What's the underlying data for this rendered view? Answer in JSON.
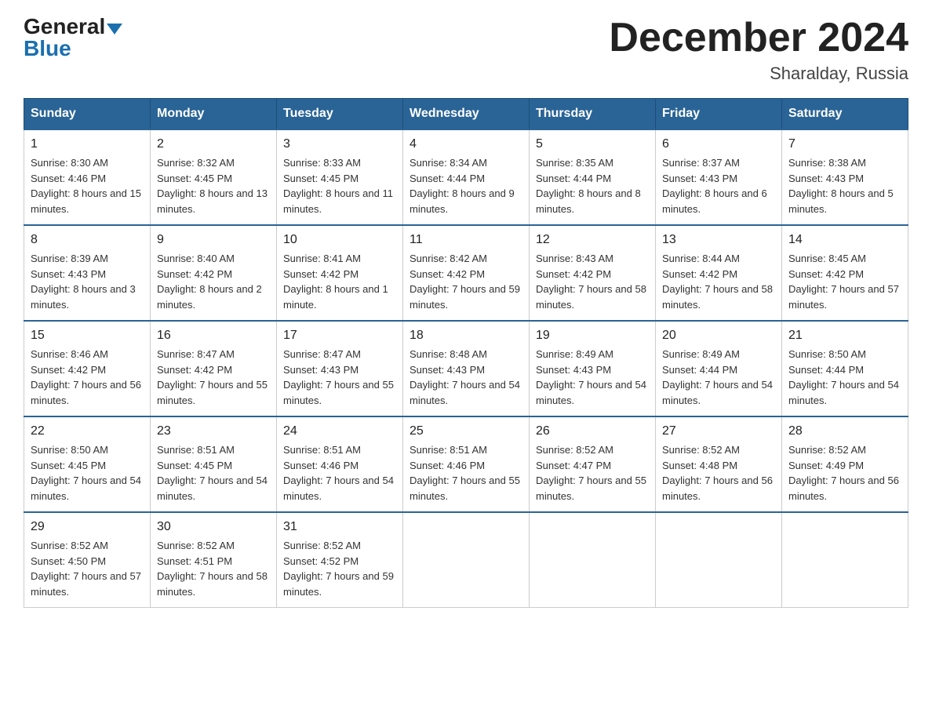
{
  "header": {
    "logo_general": "General",
    "logo_blue": "Blue",
    "month_title": "December 2024",
    "location": "Sharalday, Russia"
  },
  "days_of_week": [
    "Sunday",
    "Monday",
    "Tuesday",
    "Wednesday",
    "Thursday",
    "Friday",
    "Saturday"
  ],
  "weeks": [
    [
      {
        "day": "1",
        "sunrise": "8:30 AM",
        "sunset": "4:46 PM",
        "daylight": "8 hours and 15 minutes."
      },
      {
        "day": "2",
        "sunrise": "8:32 AM",
        "sunset": "4:45 PM",
        "daylight": "8 hours and 13 minutes."
      },
      {
        "day": "3",
        "sunrise": "8:33 AM",
        "sunset": "4:45 PM",
        "daylight": "8 hours and 11 minutes."
      },
      {
        "day": "4",
        "sunrise": "8:34 AM",
        "sunset": "4:44 PM",
        "daylight": "8 hours and 9 minutes."
      },
      {
        "day": "5",
        "sunrise": "8:35 AM",
        "sunset": "4:44 PM",
        "daylight": "8 hours and 8 minutes."
      },
      {
        "day": "6",
        "sunrise": "8:37 AM",
        "sunset": "4:43 PM",
        "daylight": "8 hours and 6 minutes."
      },
      {
        "day": "7",
        "sunrise": "8:38 AM",
        "sunset": "4:43 PM",
        "daylight": "8 hours and 5 minutes."
      }
    ],
    [
      {
        "day": "8",
        "sunrise": "8:39 AM",
        "sunset": "4:43 PM",
        "daylight": "8 hours and 3 minutes."
      },
      {
        "day": "9",
        "sunrise": "8:40 AM",
        "sunset": "4:42 PM",
        "daylight": "8 hours and 2 minutes."
      },
      {
        "day": "10",
        "sunrise": "8:41 AM",
        "sunset": "4:42 PM",
        "daylight": "8 hours and 1 minute."
      },
      {
        "day": "11",
        "sunrise": "8:42 AM",
        "sunset": "4:42 PM",
        "daylight": "7 hours and 59 minutes."
      },
      {
        "day": "12",
        "sunrise": "8:43 AM",
        "sunset": "4:42 PM",
        "daylight": "7 hours and 58 minutes."
      },
      {
        "day": "13",
        "sunrise": "8:44 AM",
        "sunset": "4:42 PM",
        "daylight": "7 hours and 58 minutes."
      },
      {
        "day": "14",
        "sunrise": "8:45 AM",
        "sunset": "4:42 PM",
        "daylight": "7 hours and 57 minutes."
      }
    ],
    [
      {
        "day": "15",
        "sunrise": "8:46 AM",
        "sunset": "4:42 PM",
        "daylight": "7 hours and 56 minutes."
      },
      {
        "day": "16",
        "sunrise": "8:47 AM",
        "sunset": "4:42 PM",
        "daylight": "7 hours and 55 minutes."
      },
      {
        "day": "17",
        "sunrise": "8:47 AM",
        "sunset": "4:43 PM",
        "daylight": "7 hours and 55 minutes."
      },
      {
        "day": "18",
        "sunrise": "8:48 AM",
        "sunset": "4:43 PM",
        "daylight": "7 hours and 54 minutes."
      },
      {
        "day": "19",
        "sunrise": "8:49 AM",
        "sunset": "4:43 PM",
        "daylight": "7 hours and 54 minutes."
      },
      {
        "day": "20",
        "sunrise": "8:49 AM",
        "sunset": "4:44 PM",
        "daylight": "7 hours and 54 minutes."
      },
      {
        "day": "21",
        "sunrise": "8:50 AM",
        "sunset": "4:44 PM",
        "daylight": "7 hours and 54 minutes."
      }
    ],
    [
      {
        "day": "22",
        "sunrise": "8:50 AM",
        "sunset": "4:45 PM",
        "daylight": "7 hours and 54 minutes."
      },
      {
        "day": "23",
        "sunrise": "8:51 AM",
        "sunset": "4:45 PM",
        "daylight": "7 hours and 54 minutes."
      },
      {
        "day": "24",
        "sunrise": "8:51 AM",
        "sunset": "4:46 PM",
        "daylight": "7 hours and 54 minutes."
      },
      {
        "day": "25",
        "sunrise": "8:51 AM",
        "sunset": "4:46 PM",
        "daylight": "7 hours and 55 minutes."
      },
      {
        "day": "26",
        "sunrise": "8:52 AM",
        "sunset": "4:47 PM",
        "daylight": "7 hours and 55 minutes."
      },
      {
        "day": "27",
        "sunrise": "8:52 AM",
        "sunset": "4:48 PM",
        "daylight": "7 hours and 56 minutes."
      },
      {
        "day": "28",
        "sunrise": "8:52 AM",
        "sunset": "4:49 PM",
        "daylight": "7 hours and 56 minutes."
      }
    ],
    [
      {
        "day": "29",
        "sunrise": "8:52 AM",
        "sunset": "4:50 PM",
        "daylight": "7 hours and 57 minutes."
      },
      {
        "day": "30",
        "sunrise": "8:52 AM",
        "sunset": "4:51 PM",
        "daylight": "7 hours and 58 minutes."
      },
      {
        "day": "31",
        "sunrise": "8:52 AM",
        "sunset": "4:52 PM",
        "daylight": "7 hours and 59 minutes."
      },
      null,
      null,
      null,
      null
    ]
  ],
  "labels": {
    "sunrise": "Sunrise:",
    "sunset": "Sunset:",
    "daylight": "Daylight:"
  }
}
